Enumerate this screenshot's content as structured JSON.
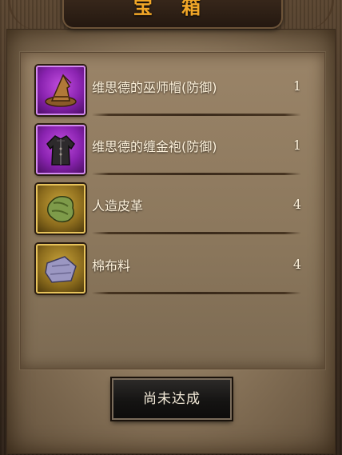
{
  "title": "宝 箱",
  "items": [
    {
      "name": "维思德的巫师帽(防御)",
      "qty": "1",
      "icon": "wizard-hat-icon",
      "rarity_color": "#8a23b0"
    },
    {
      "name": "维思德的缠金袍(防御)",
      "qty": "1",
      "icon": "robe-icon",
      "rarity_color": "#8a23b0"
    },
    {
      "name": "人造皮革",
      "qty": "4",
      "icon": "leather-icon",
      "rarity_color": "#8c6c1d"
    },
    {
      "name": "棉布料",
      "qty": "4",
      "icon": "cloth-icon",
      "rarity_color": "#8c6c1d"
    }
  ],
  "button": {
    "label": "尚未达成"
  },
  "colors": {
    "title": "#f2a728",
    "text": "#fff3dc",
    "parchment": "#8f7a5f"
  }
}
